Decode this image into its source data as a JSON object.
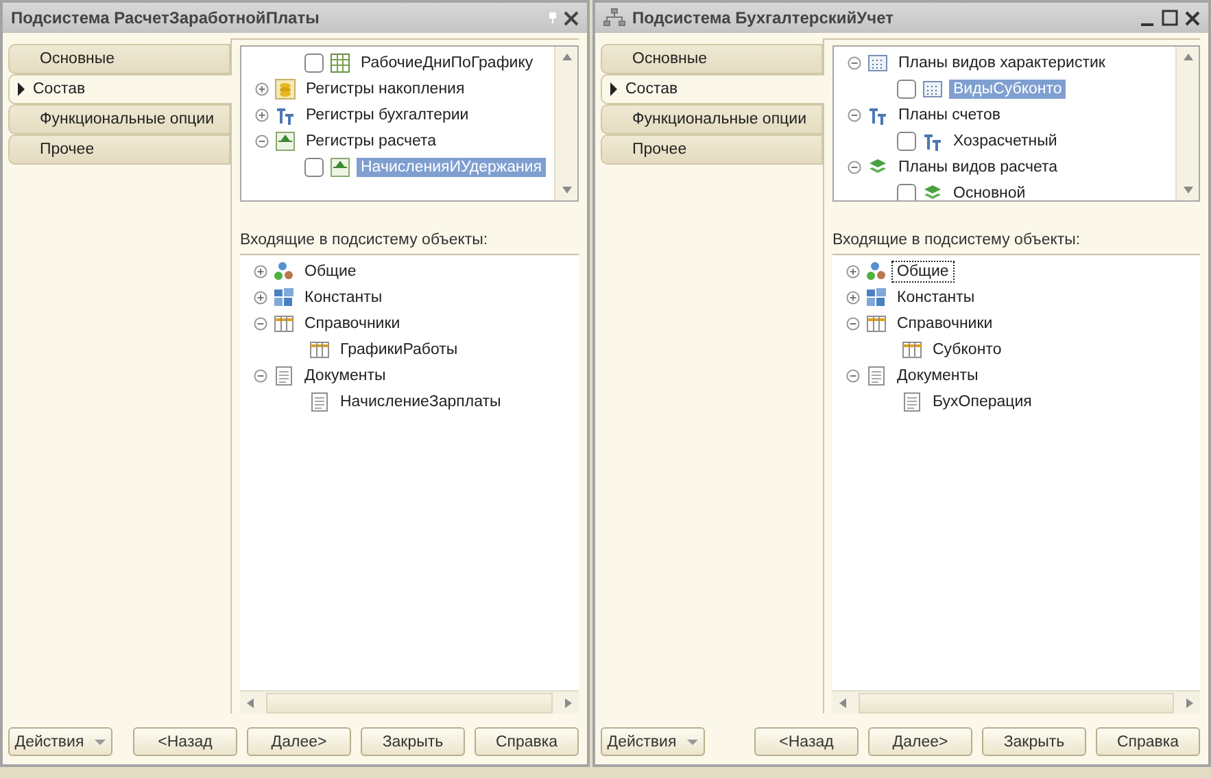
{
  "windows": [
    {
      "kind": "docked",
      "title": "Подсистема РасчетЗаработнойПлаты",
      "tabs": [
        {
          "label": "Основные",
          "selected": false
        },
        {
          "label": "Состав",
          "selected": true
        },
        {
          "label": "Функциональные опции",
          "selected": false
        },
        {
          "label": "Прочее",
          "selected": false
        }
      ],
      "top_tree": [
        {
          "kind": "grid",
          "label": "РабочиеДниПоГрафику",
          "checked": false,
          "selected": false
        },
        {
          "kind": "accumulation",
          "label": "Регистры накопления",
          "expanded": false,
          "selected": false
        },
        {
          "kind": "accounting",
          "label": "Регистры бухгалтерии",
          "expanded": false,
          "selected": false
        },
        {
          "kind": "calculation",
          "label": "Регистры расчета",
          "expanded": true,
          "selected": false,
          "children": [
            {
              "kind": "calculation",
              "label": "НачисленияИУдержания",
              "checked": false,
              "selected": true
            }
          ]
        }
      ],
      "section_label": "Входящие в подсистему объекты:",
      "bottom_tree": [
        {
          "kind": "common",
          "label": "Общие",
          "expanded": false,
          "focused": false
        },
        {
          "kind": "constants",
          "label": "Константы",
          "expanded": false,
          "focused": false
        },
        {
          "kind": "catalog",
          "label": "Справочники",
          "expanded": true,
          "focused": false,
          "children": [
            {
              "kind": "catalog",
              "label": "ГрафикиРаботы",
              "focused": false
            }
          ]
        },
        {
          "kind": "document",
          "label": "Документы",
          "expanded": true,
          "focused": false,
          "children": [
            {
              "kind": "document",
              "label": "НачислениеЗарплаты",
              "focused": false
            }
          ]
        }
      ],
      "buttons": [
        {
          "kind": "menu",
          "label": "Действия"
        },
        {
          "kind": "plain",
          "label": "<Назад"
        },
        {
          "kind": "plain",
          "label": "Далее>"
        },
        {
          "kind": "plain",
          "label": "Закрыть"
        },
        {
          "kind": "plain",
          "label": "Справка"
        }
      ]
    },
    {
      "kind": "floating",
      "title": "Подсистема БухгалтерскийУчет",
      "tabs": [
        {
          "label": "Основные",
          "selected": false
        },
        {
          "label": "Состав",
          "selected": true
        },
        {
          "label": "Функциональные опции",
          "selected": false
        },
        {
          "label": "Прочее",
          "selected": false
        }
      ],
      "top_tree": [
        {
          "kind": "characteristics",
          "label": "Планы видов характеристик",
          "expanded": true,
          "selected": false,
          "children": [
            {
              "kind": "characteristics",
              "label": "ВидыСубконто",
              "checked": false,
              "selected": true
            }
          ]
        },
        {
          "kind": "accounting",
          "label": "Планы счетов",
          "expanded": true,
          "selected": false,
          "children": [
            {
              "kind": "accounting",
              "label": "Хозрасчетный",
              "checked": false,
              "selected": false
            }
          ]
        },
        {
          "kind": "layers",
          "label": "Планы видов расчета",
          "expanded": true,
          "selected": false,
          "children": [
            {
              "kind": "layers",
              "label": "Основной",
              "checked": false,
              "selected": false
            }
          ]
        }
      ],
      "section_label": "Входящие в подсистему объекты:",
      "bottom_tree": [
        {
          "kind": "common",
          "label": "Общие",
          "expanded": false,
          "focused": true
        },
        {
          "kind": "constants",
          "label": "Константы",
          "expanded": false,
          "focused": false
        },
        {
          "kind": "catalog",
          "label": "Справочники",
          "expanded": true,
          "focused": false,
          "children": [
            {
              "kind": "catalog",
              "label": "Субконто",
              "focused": false
            }
          ]
        },
        {
          "kind": "document",
          "label": "Документы",
          "expanded": true,
          "focused": false,
          "children": [
            {
              "kind": "document",
              "label": "БухОперация",
              "focused": false
            }
          ]
        }
      ],
      "buttons": [
        {
          "kind": "menu",
          "label": "Действия"
        },
        {
          "kind": "plain",
          "label": "<Назад"
        },
        {
          "kind": "plain",
          "label": "Далее>"
        },
        {
          "kind": "plain",
          "label": "Закрыть"
        },
        {
          "kind": "plain",
          "label": "Справка"
        }
      ]
    }
  ]
}
